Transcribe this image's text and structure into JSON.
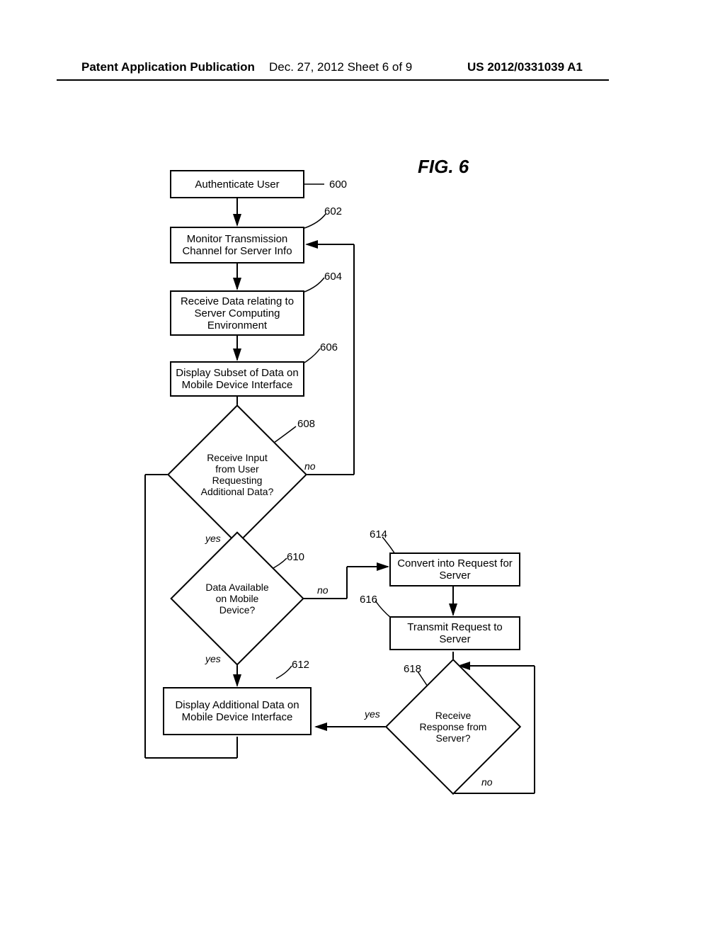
{
  "header": {
    "left": "Patent Application Publication",
    "center": "Dec. 27, 2012  Sheet 6 of 9",
    "right": "US 2012/0331039 A1"
  },
  "figure_title": "FIG. 6",
  "boxes": {
    "b600": "Authenticate User",
    "b602": "Monitor Transmission Channel for Server Info",
    "b604": "Receive Data relating to Server Computing Environment",
    "b606": "Display Subset of Data on Mobile Device Interface",
    "b612": "Display Additional Data on Mobile Device Interface",
    "b614": "Convert into Request for Server",
    "b616": "Transmit Request to Server"
  },
  "diamonds": {
    "d608": "Receive Input from User Requesting Additional Data?",
    "d610": "Data Available on Mobile Device?",
    "d618": "Receive Response from Server?"
  },
  "refs": {
    "r600": "600",
    "r602": "602",
    "r604": "604",
    "r606": "606",
    "r608": "608",
    "r610": "610",
    "r612": "612",
    "r614": "614",
    "r616": "616",
    "r618": "618"
  },
  "edges": {
    "yes": "yes",
    "no": "no"
  }
}
